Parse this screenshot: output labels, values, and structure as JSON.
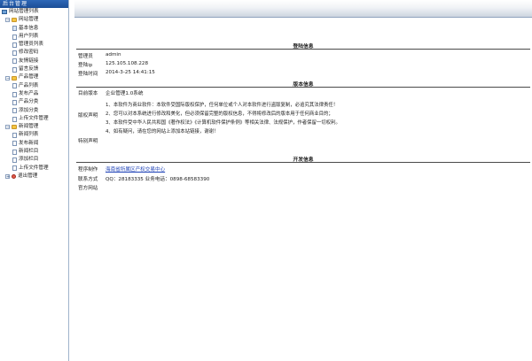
{
  "sidebar": {
    "header": "后台管理",
    "root": "网站管理列表",
    "groups": [
      {
        "label": "网站管理",
        "items": [
          "基本信息",
          "用户列表",
          "管理员列表",
          "修改密码",
          "友情链接",
          "留言反馈"
        ]
      },
      {
        "label": "产品管理",
        "items": [
          "产品列表",
          "发布产品",
          "产品分类",
          "添加分类",
          "上传文件管理"
        ]
      },
      {
        "label": "新闻管理",
        "items": [
          "新闻列表",
          "发布新闻",
          "新闻栏目",
          "添加栏目",
          "上传文件管理"
        ]
      }
    ],
    "exit": "退出管理"
  },
  "login": {
    "title": "登陆信息",
    "rows": [
      {
        "label": "管理员",
        "value": "admin"
      },
      {
        "label": "登陆ip",
        "value": "125.105.108.228"
      },
      {
        "label": "登陆时间",
        "value": "2014-3-25 14:41:15"
      }
    ]
  },
  "version": {
    "title": "版本信息",
    "current_label": "目前版本",
    "current_value": "企业管理1.0系统",
    "copyright_label": "版权声明",
    "copyright_lines": [
      "1、本软件为商业软件：本软件受国际版权保护，任何单位或个人对本软件进行盗版复制，必追究其法律责任！",
      "2、您可以对本系统进行修改和美化，但必须保留完整的版权信息，不得将修改后的版本用于任何商业目的；",
      "3、本软件受中华人民共和国《著作权法》《计算机软件保护条例》等相关法律、法规保护，作者保留一切权利。",
      "4、如有疑问，请在您的网站上添加本站链接，谢谢！"
    ],
    "special_label": "特别声明"
  },
  "dev": {
    "title": "开发信息",
    "maker_label": "程序制作",
    "maker_value": "海南省所属区产权交易中心",
    "contact_label": "联系方式",
    "contact_value": "QQ：28183335  业务电话：0898-68583390",
    "site_label": "官方网站"
  }
}
